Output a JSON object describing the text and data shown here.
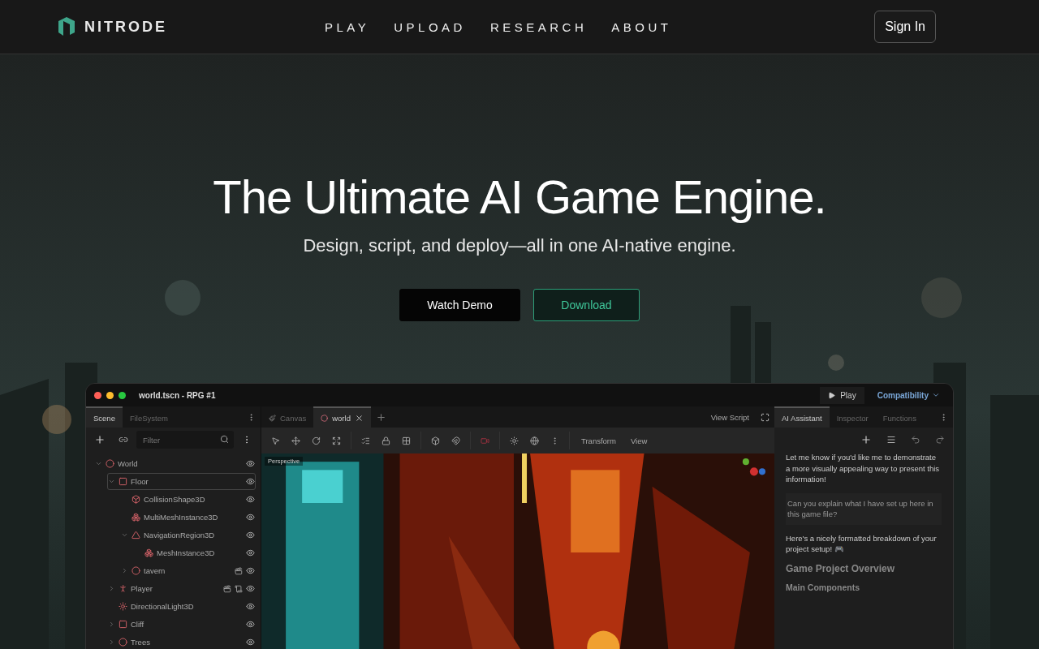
{
  "header": {
    "logo": "NITRODE",
    "nav": [
      {
        "label": "PLAY"
      },
      {
        "label": "UPLOAD"
      },
      {
        "label": "RESEARCH"
      },
      {
        "label": "ABOUT"
      }
    ],
    "sign_in": "Sign In"
  },
  "hero": {
    "title": "The Ultimate AI Game Engine.",
    "subtitle": "Design, script, and deploy—all in one AI-native engine.",
    "buttons": [
      {
        "label": "Watch Demo",
        "kind": "solid"
      },
      {
        "label": "Download",
        "kind": "outline"
      }
    ]
  },
  "editor": {
    "title": "world.tscn - RPG #1",
    "play": "Play",
    "renderer": "Compatibility",
    "left_tabs": [
      {
        "label": "Scene",
        "selected": true
      },
      {
        "label": "FileSystem",
        "selected": false
      }
    ],
    "filter": {
      "placeholder": "Filter"
    },
    "tree": [
      {
        "name": "World",
        "kind": "circle",
        "expanded": true,
        "selected": false,
        "children": [
          {
            "name": "Floor",
            "kind": "square",
            "expanded": true,
            "selected": true,
            "children": [
              {
                "name": "CollisionShape3D",
                "kind": "cube",
                "selected": false
              },
              {
                "name": "MultiMeshInstance3D",
                "kind": "mesh",
                "selected": false
              },
              {
                "name": "NavigationRegion3D",
                "kind": "nav",
                "expanded": true,
                "selected": false,
                "children": [
                  {
                    "name": "MeshInstance3D",
                    "kind": "mesh",
                    "selected": false
                  }
                ]
              },
              {
                "name": "tavern",
                "kind": "circle",
                "expanded": false,
                "selected": false,
                "scene": true
              }
            ]
          },
          {
            "name": "Player",
            "kind": "person",
            "expanded": false,
            "selected": false,
            "scene": true,
            "script": true
          },
          {
            "name": "DirectionalLight3D",
            "kind": "sun",
            "selected": false
          },
          {
            "name": "Cliff",
            "kind": "square",
            "expanded": false,
            "selected": false
          },
          {
            "name": "Trees",
            "kind": "circle",
            "expanded": false,
            "selected": false
          }
        ]
      }
    ],
    "center_tabs": [
      {
        "label": "Canvas",
        "kind": "brush",
        "selected": false
      },
      {
        "label": "world",
        "kind": "scene",
        "selected": true
      }
    ],
    "view_script": "View Script",
    "toolbar_menus": [
      "Transform",
      "View"
    ],
    "viewport_label": "Perspective",
    "right_tabs": [
      {
        "label": "AI Assistant",
        "selected": true
      },
      {
        "label": "Inspector",
        "selected": false
      },
      {
        "label": "Functions",
        "selected": false
      }
    ],
    "messages": [
      {
        "kind": "assistant",
        "text": "Let me know if you'd like me to demonstrate a more visually appealing way to present this information!"
      },
      {
        "kind": "user",
        "text": "Can you explain what I have set up here in this game file?"
      },
      {
        "kind": "assistant",
        "text": "Here's a nicely formatted breakdown of your project setup! 🎮"
      },
      {
        "kind": "heading",
        "text": "Game Project Overview"
      },
      {
        "kind": "subheading",
        "text": "Main Components"
      }
    ]
  }
}
